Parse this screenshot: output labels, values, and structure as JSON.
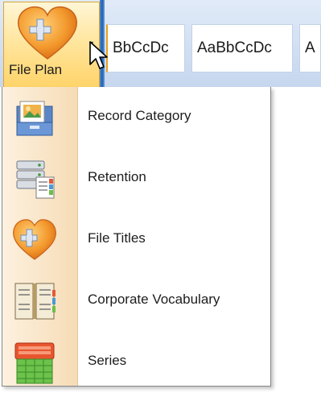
{
  "ribbon": {
    "file_plan_label": "File Plan",
    "styles": [
      "BbCcDc",
      "AaBbCcDc",
      "A"
    ]
  },
  "menu": {
    "items": [
      {
        "label": "Record Category",
        "icon": "record-category-icon"
      },
      {
        "label": "Retention",
        "icon": "retention-icon"
      },
      {
        "label": "File Titles",
        "icon": "file-titles-icon"
      },
      {
        "label": "Corporate Vocabulary",
        "icon": "corporate-vocabulary-icon"
      },
      {
        "label": "Series",
        "icon": "series-icon"
      }
    ]
  },
  "colors": {
    "heart": "#f39a2e",
    "hover_gradient": "#ffd46a",
    "menu_gutter": "#f6dcb6"
  }
}
